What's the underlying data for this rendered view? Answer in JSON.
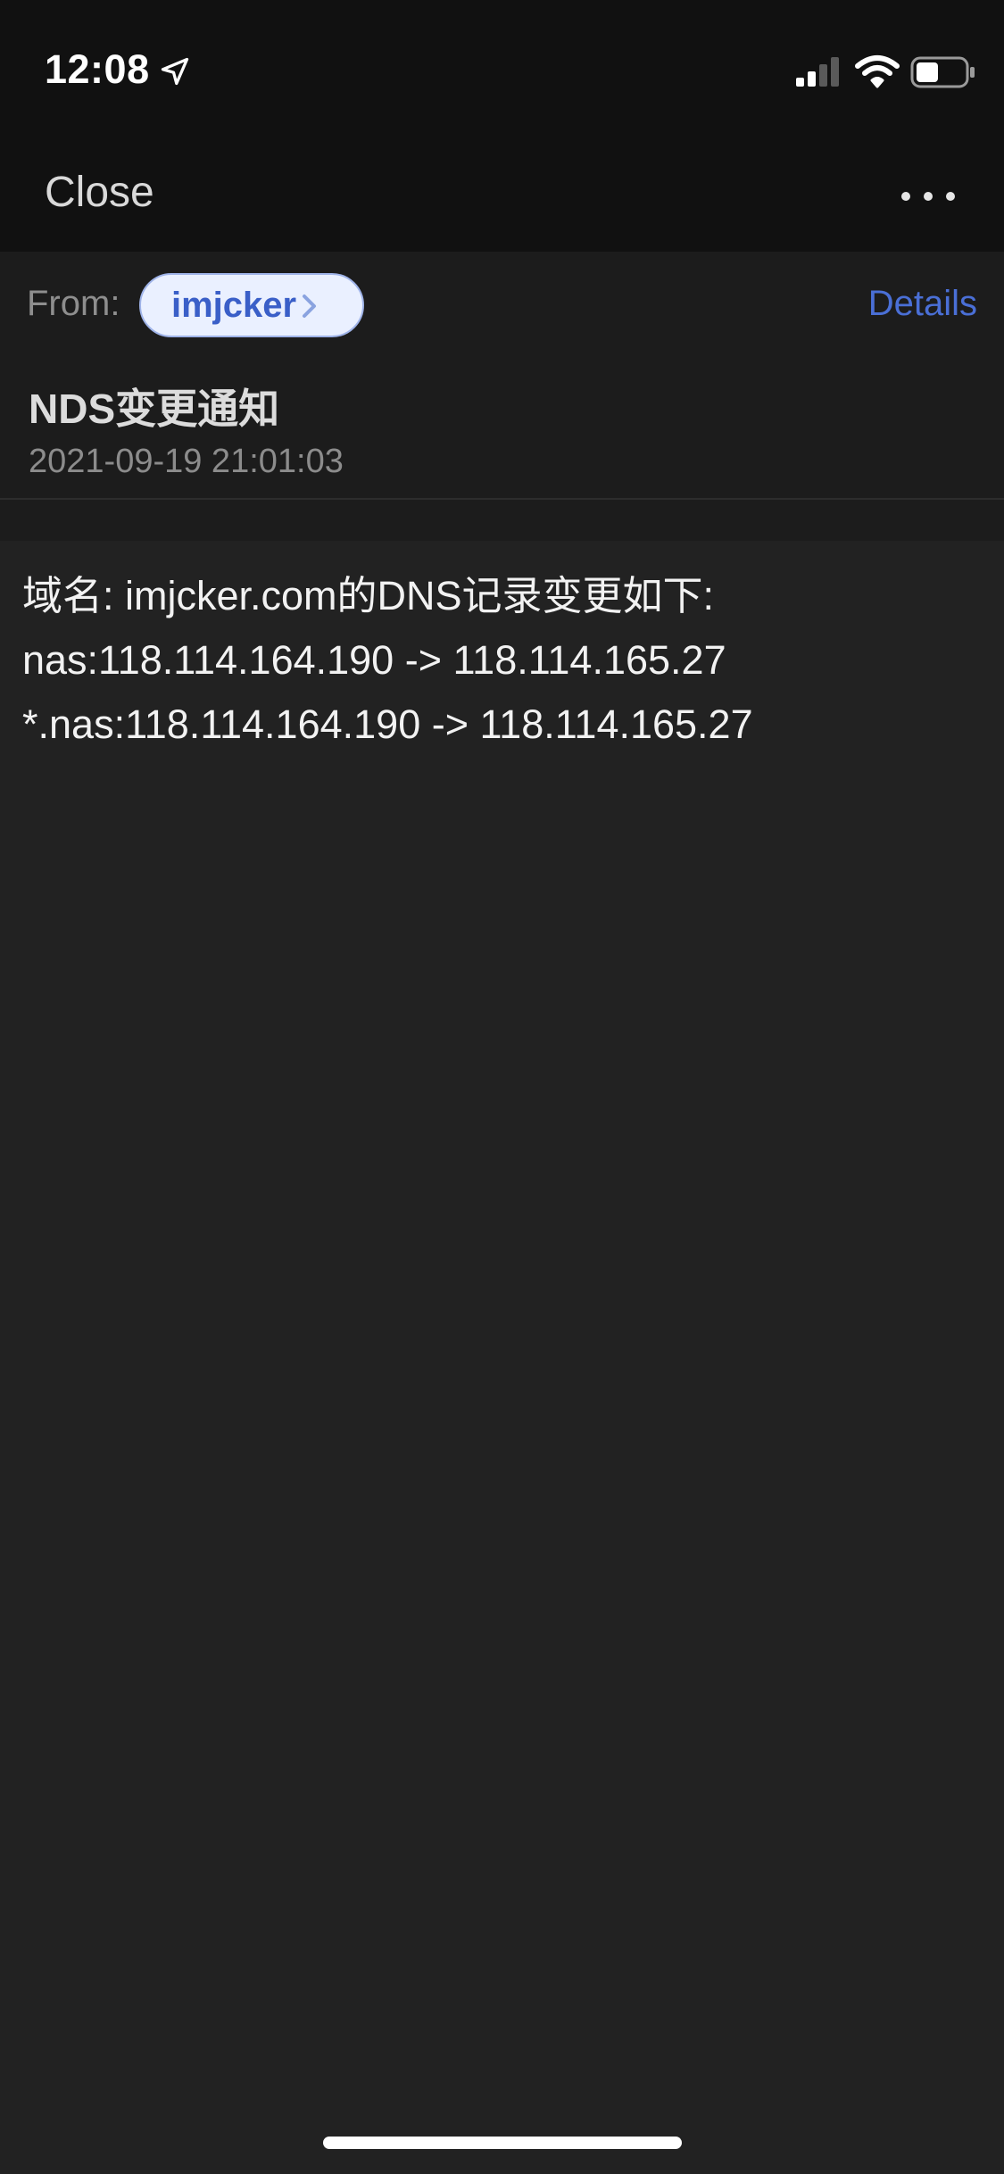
{
  "status_bar": {
    "time": "12:08"
  },
  "nav": {
    "close_label": "Close",
    "more_icon": "ellipsis-icon"
  },
  "header": {
    "from_label": "From:",
    "sender": "imjcker",
    "details_label": "Details"
  },
  "subject": {
    "title": "NDS变更通知",
    "date": "2021-09-19 21:01:03"
  },
  "body": {
    "lines": [
      "域名: imjcker.com的DNS记录变更如下:",
      "nas:118.114.164.190 -> 118.114.165.27",
      "*.nas:118.114.164.190 -> 118.114.165.27"
    ]
  },
  "colors": {
    "background": "#222222",
    "bar": "#111111",
    "accent": "#4a6fd6",
    "chip_bg": "#eaf0ff"
  }
}
